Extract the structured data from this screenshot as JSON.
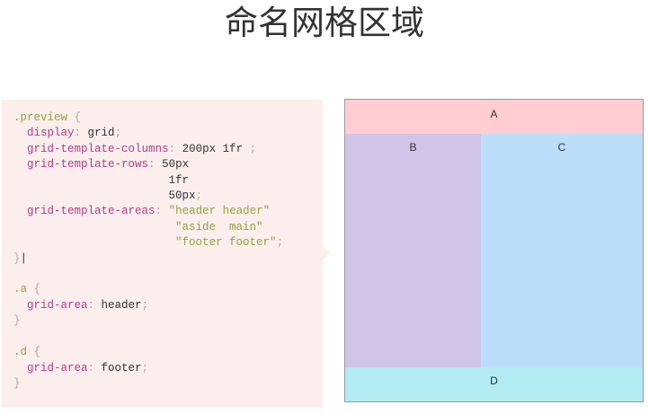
{
  "title": "命名网格区域",
  "code": {
    "l1_sel": ".preview",
    "l1_brace": " {",
    "l2_prop": "display",
    "l2_val": "grid",
    "l3_prop": "grid-template-columns",
    "l3_val": "200px 1fr",
    "l4_prop": "grid-template-rows",
    "l4_val": "50px",
    "l5_val": "1fr",
    "l6_val": "50px",
    "l7_prop": "grid-template-areas",
    "l7_val": "\"header header\"",
    "l8_val": "\"aside  main\"",
    "l9_val": "\"footer footer\"",
    "l10_close": "}",
    "l12_sel": ".a",
    "l13_prop": "grid-area",
    "l13_val": "header",
    "l15_sel": ".d",
    "l16_prop": "grid-area",
    "l16_val": "footer"
  },
  "preview": {
    "a": "A",
    "b": "B",
    "c": "C",
    "d": "D"
  },
  "colors": {
    "a": "#ffcdd2",
    "b": "#d1c4e9",
    "c": "#bbdefb",
    "d": "#b2ebf2",
    "code_bg": "#fdeeee"
  }
}
